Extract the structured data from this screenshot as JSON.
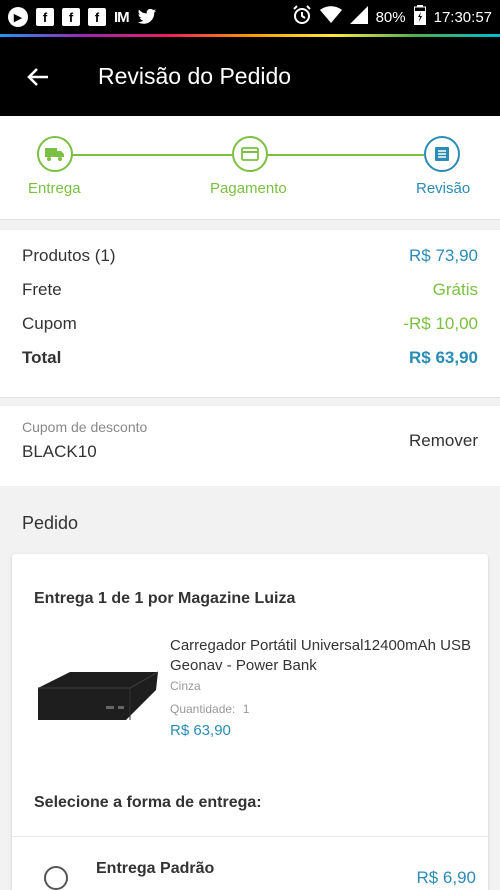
{
  "status_bar": {
    "battery": "80%",
    "time": "17:30:57"
  },
  "app_bar": {
    "title": "Revisão do Pedido"
  },
  "steps": [
    {
      "label": "Entrega",
      "icon": "truck-icon"
    },
    {
      "label": "Pagamento",
      "icon": "card-icon"
    },
    {
      "label": "Revisão",
      "icon": "list-icon"
    }
  ],
  "summary": {
    "products_label": "Produtos (1)",
    "products_value": "R$ 73,90",
    "shipping_label": "Frete",
    "shipping_value": "Grátis",
    "coupon_label": "Cupom",
    "coupon_value": "-R$ 10,00",
    "total_label": "Total",
    "total_value": "R$ 63,90"
  },
  "coupon": {
    "label": "Cupom de desconto",
    "code": "BLACK10",
    "remove_label": "Remover"
  },
  "order": {
    "title": "Pedido",
    "delivery_heading": "Entrega 1 de 1 por Magazine Luiza",
    "product": {
      "name": "Carregador Portátil Universal12400mAh USB Geonav - Power Bank",
      "color": "Cinza",
      "quantity_label": "Quantidade:",
      "quantity": "1",
      "price": "R$ 63,90"
    },
    "shipping_select_label": "Selecione a forma de entrega:",
    "shipping_option": {
      "name": "Entrega Padrão",
      "price": "R$ 6,90"
    }
  },
  "colors": {
    "green": "#7bc043",
    "blue": "#2a8cb5"
  }
}
